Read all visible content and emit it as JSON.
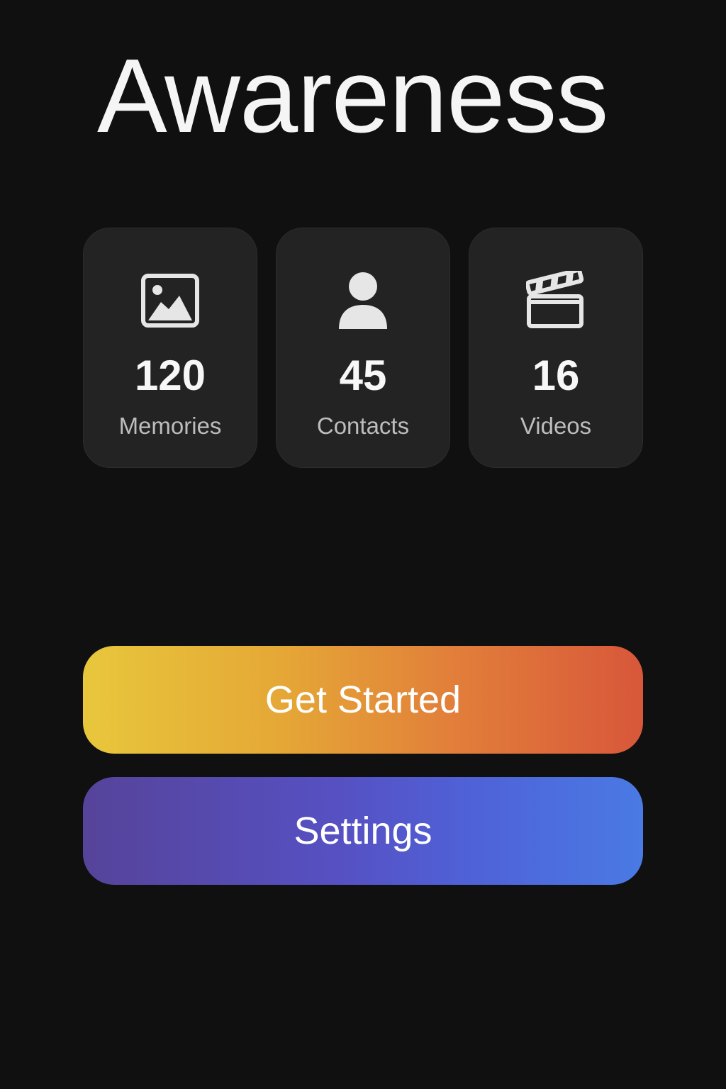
{
  "app": {
    "title": "Awareness"
  },
  "stats": [
    {
      "icon": "image-icon",
      "value": "120",
      "label": "Memories"
    },
    {
      "icon": "person-icon",
      "value": "45",
      "label": "Contacts"
    },
    {
      "icon": "clapperboard-icon",
      "value": "16",
      "label": "Videos"
    }
  ],
  "actions": {
    "primary_label": "Get Started",
    "secondary_label": "Settings"
  },
  "colors": {
    "background": "#101010",
    "card": "#232323",
    "primary_gradient": [
      "#e8c73c",
      "#d8573a"
    ],
    "secondary_gradient": [
      "#56449a",
      "#4a7ae4"
    ]
  }
}
